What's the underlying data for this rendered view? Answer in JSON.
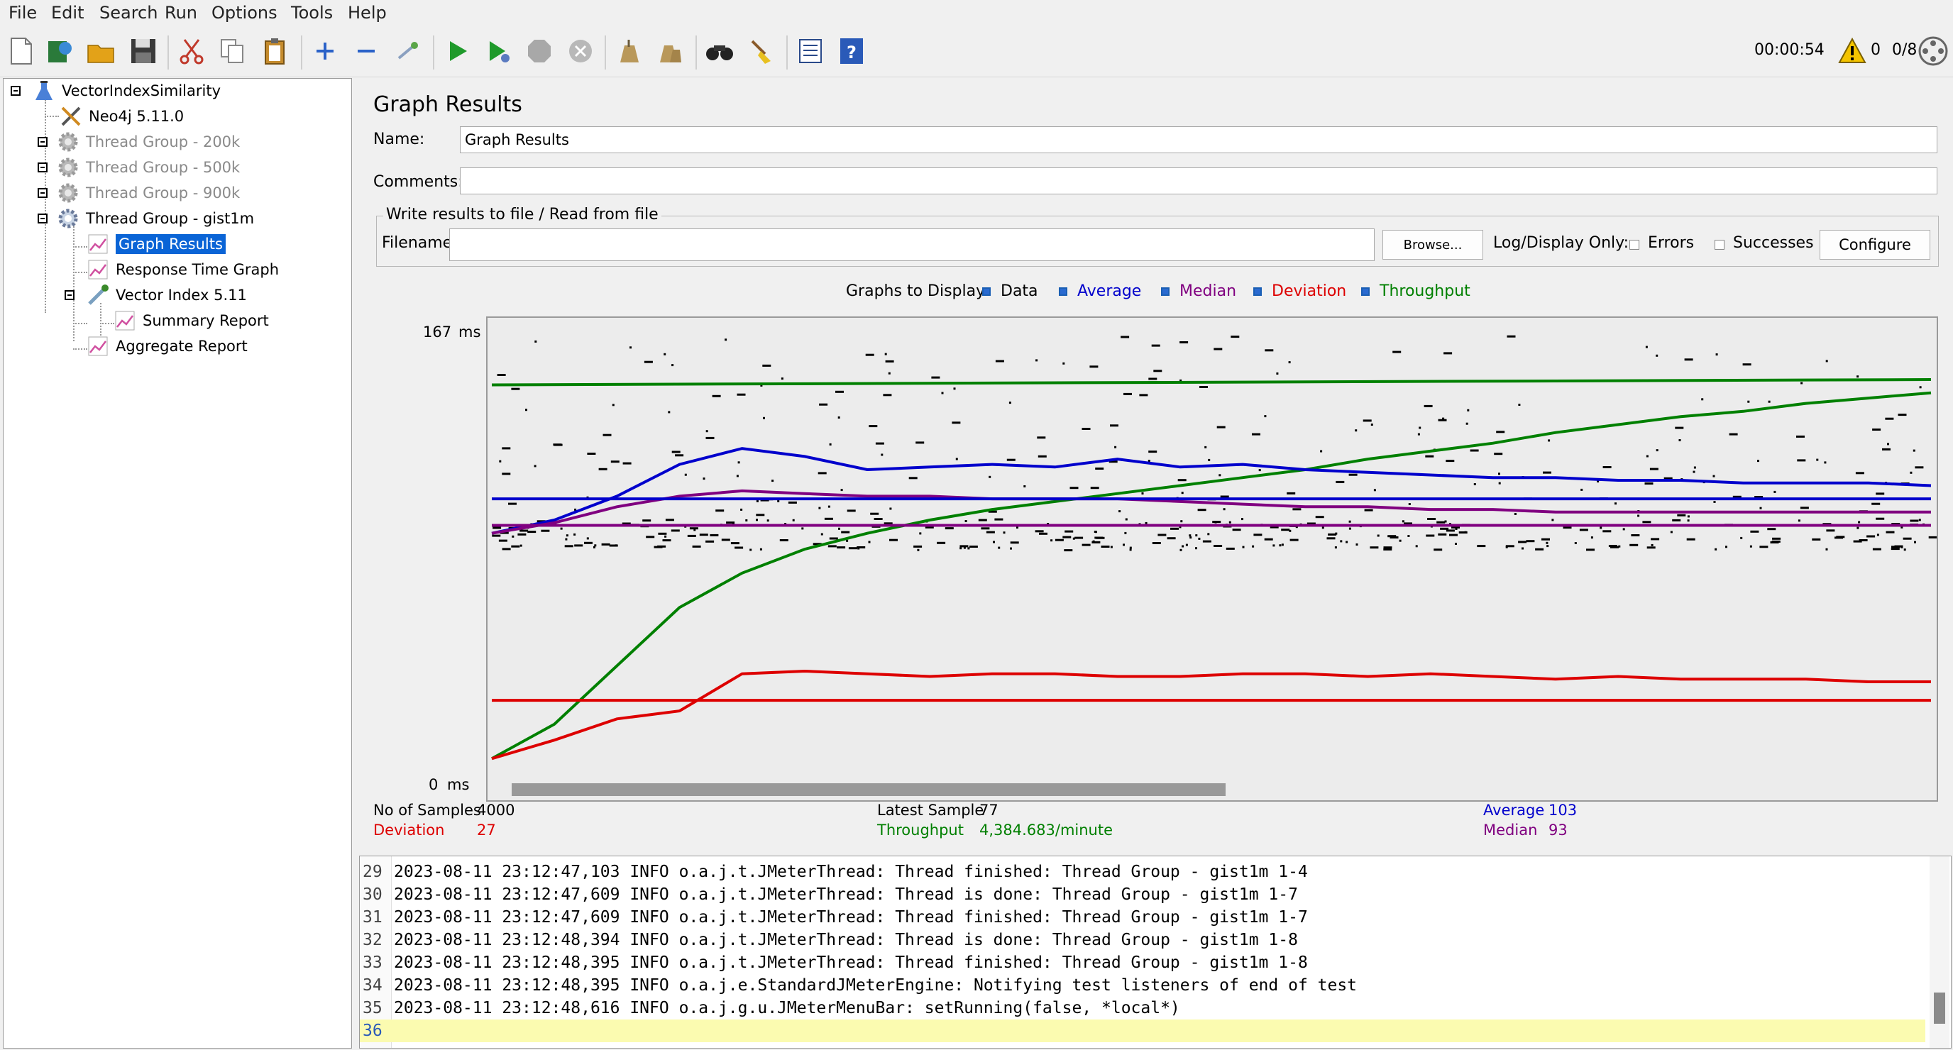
{
  "menu": [
    "File",
    "Edit",
    "Search",
    "Run",
    "Options",
    "Tools",
    "Help"
  ],
  "toolbar": {
    "timer": "00:00:54",
    "warning_count": "0",
    "threads": "0/8"
  },
  "tree": {
    "items": [
      {
        "label": "VectorIndexSimilarity",
        "icon": "test-plan-icon",
        "dim": false
      },
      {
        "label": "Neo4j 5.11.0",
        "icon": "config-tools-icon",
        "dim": false
      },
      {
        "label": "Thread Group - 200k",
        "icon": "gear-icon",
        "dim": true
      },
      {
        "label": "Thread Group - 500k",
        "icon": "gear-icon",
        "dim": true
      },
      {
        "label": "Thread Group - 900k",
        "icon": "gear-icon",
        "dim": true
      },
      {
        "label": "Thread Group - gist1m",
        "icon": "gear-icon",
        "dim": false
      },
      {
        "label": "Graph Results",
        "icon": "graph-icon",
        "dim": false,
        "selected": true
      },
      {
        "label": "Response Time Graph",
        "icon": "graph-icon",
        "dim": false
      },
      {
        "label": "Vector Index 5.11",
        "icon": "pipette-icon",
        "dim": false
      },
      {
        "label": "Summary Report",
        "icon": "graph-icon",
        "dim": false
      },
      {
        "label": "Aggregate Report",
        "icon": "graph-icon",
        "dim": false
      }
    ]
  },
  "panel": {
    "title": "Graph Results",
    "name_label": "Name:",
    "name_value": "Graph Results",
    "comments_label": "Comments:",
    "comments_value": "",
    "file_group_title": "Write results to file / Read from file",
    "filename_label": "Filename",
    "filename_value": "",
    "browse_label": "Browse...",
    "log_display_label": "Log/Display Only:",
    "errors_label": "Errors",
    "successes_label": "Successes",
    "configure_label": "Configure"
  },
  "legend": {
    "title": "Graphs to Display",
    "items": [
      {
        "label": "Data",
        "color": "#000000"
      },
      {
        "label": "Average",
        "color": "#0000cc"
      },
      {
        "label": "Median",
        "color": "#800080"
      },
      {
        "label": "Deviation",
        "color": "#dd0000"
      },
      {
        "label": "Throughput",
        "color": "#008000"
      }
    ]
  },
  "chart_data": {
    "type": "line",
    "title": "",
    "ylabel": "ms",
    "ylim": [
      0,
      167
    ],
    "y_max_label": "167",
    "y_min_label": "0",
    "y_unit": "ms",
    "series": [
      {
        "name": "Throughput",
        "color": "#008000",
        "values": [
          5,
          18,
          40,
          62,
          75,
          84,
          90,
          95,
          99,
          102,
          105,
          108,
          111,
          114,
          118,
          121,
          124,
          128,
          131,
          134,
          136,
          139,
          141,
          143
        ]
      },
      {
        "name": "Average",
        "color": "#0000cc",
        "values": [
          90,
          95,
          104,
          116,
          122,
          119,
          114,
          115,
          116,
          115,
          118,
          115,
          116,
          114,
          113,
          112,
          111,
          111,
          110,
          110,
          109,
          109,
          109,
          108
        ]
      },
      {
        "name": "Median",
        "color": "#800080",
        "values": [
          90,
          94,
          100,
          104,
          106,
          105,
          104,
          104,
          103,
          103,
          103,
          102,
          101,
          100,
          100,
          99,
          99,
          98,
          98,
          98,
          98,
          98,
          98,
          98
        ]
      },
      {
        "name": "Deviation",
        "color": "#dd0000",
        "values": [
          5,
          12,
          20,
          23,
          37,
          38,
          37,
          36,
          37,
          37,
          36,
          36,
          37,
          37,
          36,
          37,
          36,
          35,
          36,
          35,
          35,
          35,
          34,
          34
        ]
      },
      {
        "name": "Average (reference)",
        "color": "#0000cc",
        "values": [
          103,
          103
        ]
      },
      {
        "name": "Median (reference)",
        "color": "#800080",
        "values": [
          93,
          93
        ]
      },
      {
        "name": "Deviation (reference)",
        "color": "#dd0000",
        "values": [
          27,
          27
        ]
      },
      {
        "name": "Throughput (reference)",
        "color": "#008000",
        "values": [
          146,
          148
        ]
      }
    ]
  },
  "stats": {
    "samples_label": "No of Samples",
    "samples_value": "4000",
    "deviation_label": "Deviation",
    "deviation_value": "27",
    "latest_label": "Latest Sample",
    "latest_value": "77",
    "throughput_label": "Throughput",
    "throughput_value": "4,384.683/minute",
    "average_label": "Average",
    "average_value": "103",
    "median_label": "Median",
    "median_value": "93"
  },
  "log": [
    {
      "num": "29",
      "text": "2023-08-11 23:12:47,103 INFO o.a.j.t.JMeterThread: Thread finished: Thread Group - gist1m 1-4"
    },
    {
      "num": "30",
      "text": "2023-08-11 23:12:47,609 INFO o.a.j.t.JMeterThread: Thread is done: Thread Group - gist1m 1-7"
    },
    {
      "num": "31",
      "text": "2023-08-11 23:12:47,609 INFO o.a.j.t.JMeterThread: Thread finished: Thread Group - gist1m 1-7"
    },
    {
      "num": "32",
      "text": "2023-08-11 23:12:48,394 INFO o.a.j.t.JMeterThread: Thread is done: Thread Group - gist1m 1-8"
    },
    {
      "num": "33",
      "text": "2023-08-11 23:12:48,395 INFO o.a.j.t.JMeterThread: Thread finished: Thread Group - gist1m 1-8"
    },
    {
      "num": "34",
      "text": "2023-08-11 23:12:48,395 INFO o.a.j.e.StandardJMeterEngine: Notifying test listeners of end of test"
    },
    {
      "num": "35",
      "text": "2023-08-11 23:12:48,616 INFO o.a.j.g.u.JMeterMenuBar: setRunning(false, *local*)"
    },
    {
      "num": "36",
      "text": ""
    }
  ]
}
